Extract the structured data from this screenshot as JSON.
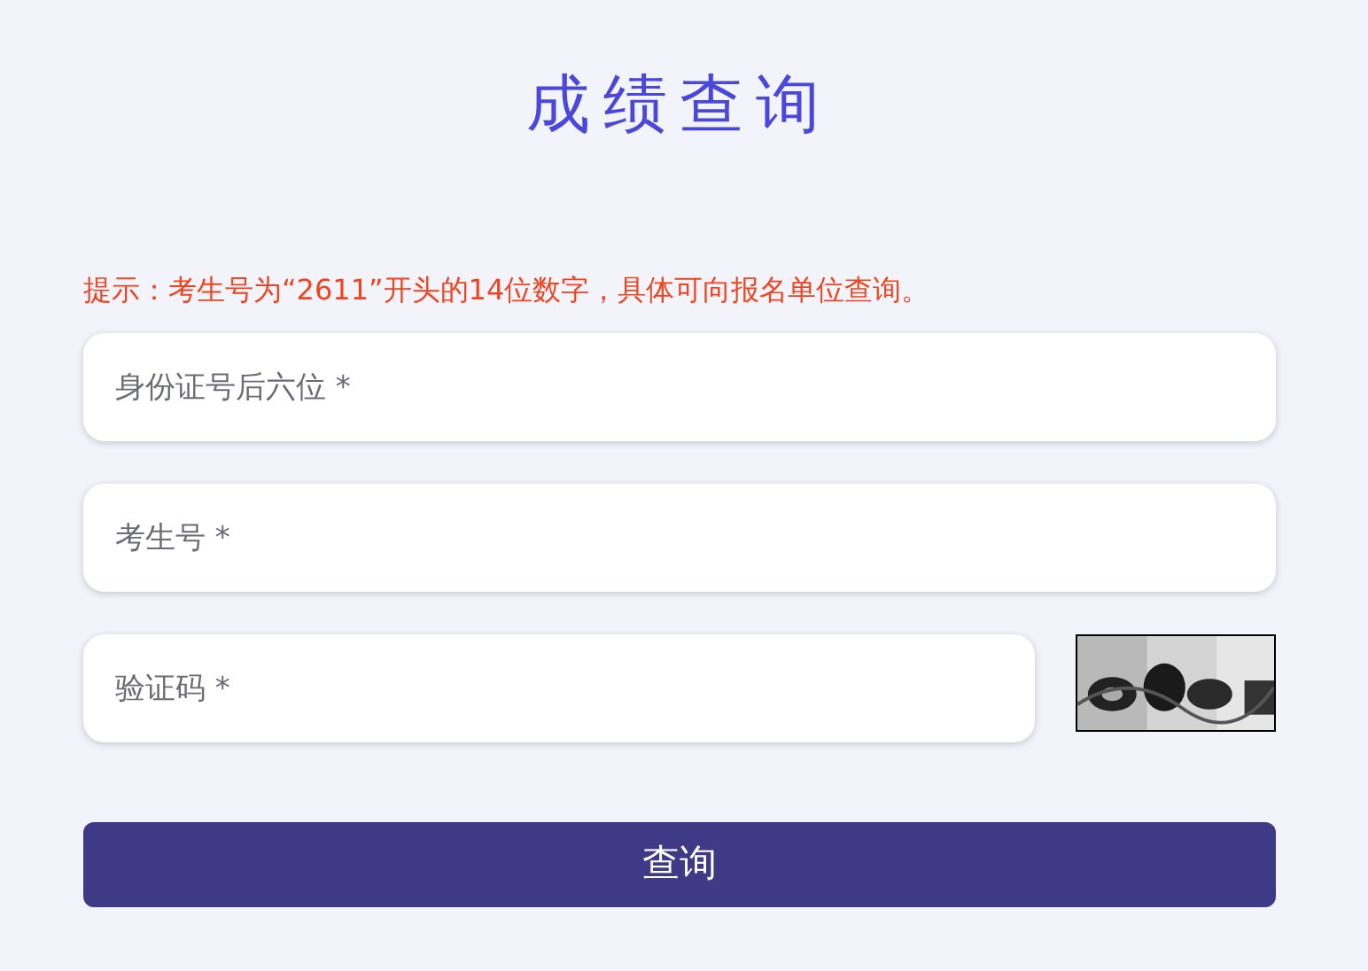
{
  "title": "成绩查询",
  "hint": "提示：考生号为“2611”开头的14位数字，具体可向报名单位查询。",
  "fields": [
    {
      "placeholder": "身份证号后六位 *"
    },
    {
      "placeholder": "考生号 *"
    },
    {
      "placeholder": "验证码 *"
    }
  ],
  "button": {
    "label": "查询"
  }
}
